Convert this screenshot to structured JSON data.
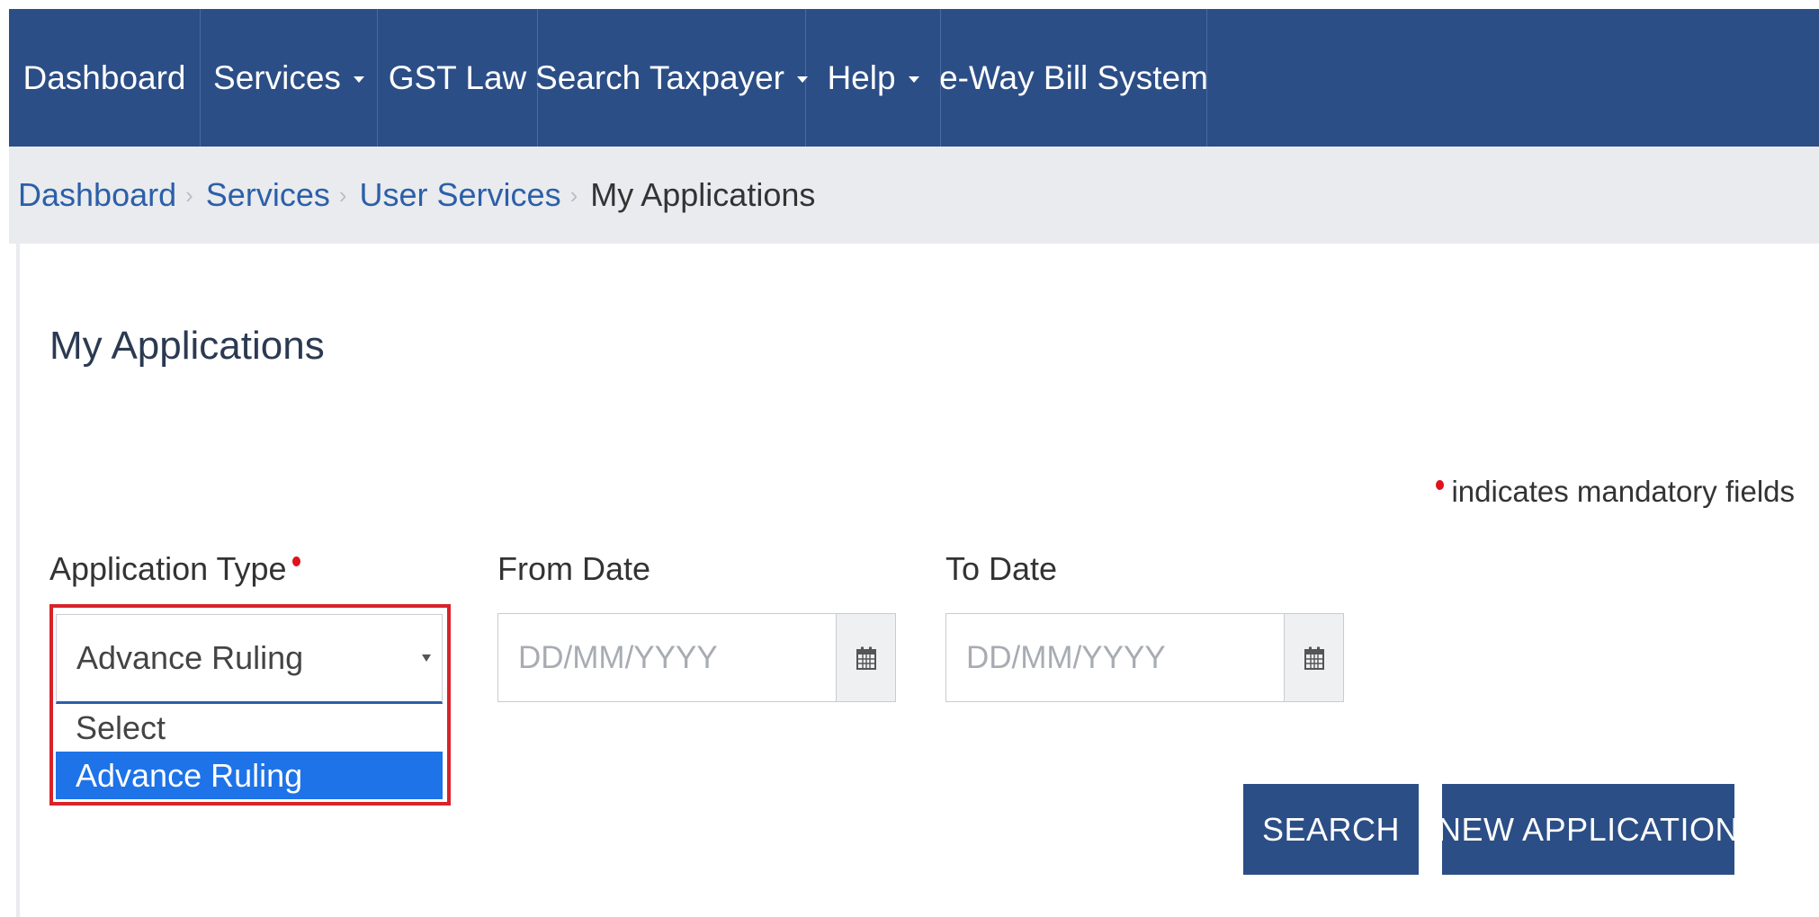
{
  "nav": {
    "items": [
      {
        "label": "Dashboard",
        "has_dropdown": false
      },
      {
        "label": "Services",
        "has_dropdown": true
      },
      {
        "label": "GST Law",
        "has_dropdown": false
      },
      {
        "label": "Search Taxpayer",
        "has_dropdown": true
      },
      {
        "label": "Help",
        "has_dropdown": true
      },
      {
        "label": "e-Way Bill System",
        "has_dropdown": false
      }
    ]
  },
  "breadcrumb": {
    "items": [
      "Dashboard",
      "Services",
      "User Services"
    ],
    "current": "My Applications"
  },
  "page": {
    "title": "My Applications",
    "mandatory_note": "indicates mandatory fields"
  },
  "form": {
    "application_type": {
      "label": "Application Type",
      "value": "Advance Ruling",
      "options": [
        "Select",
        "Advance Ruling"
      ],
      "highlighted_option": "Advance Ruling"
    },
    "from_date": {
      "label": "From Date",
      "placeholder": "DD/MM/YYYY"
    },
    "to_date": {
      "label": "To Date",
      "placeholder": "DD/MM/YYYY"
    }
  },
  "buttons": {
    "search": "SEARCH",
    "new_application": "NEW APPLICATION"
  },
  "icons": {
    "calendar": "calendar-icon",
    "caret": "caret-down-icon",
    "mandatory": "mandatory-dot-icon"
  },
  "colors": {
    "nav_bg": "#2c4e86",
    "breadcrumb_bg": "#e9ebef",
    "link": "#2c5fa8",
    "highlight_border": "#d9222a",
    "selected_option": "#1e73e8",
    "mandatory": "#e0121c"
  }
}
